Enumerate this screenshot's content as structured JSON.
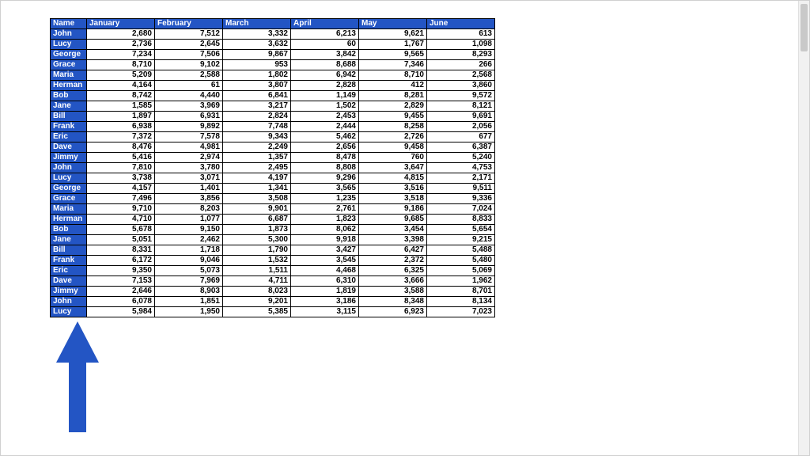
{
  "table": {
    "headers": [
      "Name",
      "January",
      "February",
      "March",
      "April",
      "May",
      "June"
    ],
    "rows": [
      {
        "name": "John",
        "values": [
          "2,680",
          "7,512",
          "3,332",
          "6,213",
          "9,621",
          "613"
        ]
      },
      {
        "name": "Lucy",
        "values": [
          "2,736",
          "2,645",
          "3,632",
          "60",
          "1,767",
          "1,098"
        ]
      },
      {
        "name": "George",
        "values": [
          "7,234",
          "7,506",
          "9,867",
          "3,842",
          "9,565",
          "8,293"
        ]
      },
      {
        "name": "Grace",
        "values": [
          "8,710",
          "9,102",
          "953",
          "8,688",
          "7,346",
          "266"
        ]
      },
      {
        "name": "Maria",
        "values": [
          "5,209",
          "2,588",
          "1,802",
          "6,942",
          "8,710",
          "2,568"
        ]
      },
      {
        "name": "Herman",
        "values": [
          "4,164",
          "61",
          "3,807",
          "2,828",
          "412",
          "3,860"
        ]
      },
      {
        "name": "Bob",
        "values": [
          "8,742",
          "4,440",
          "6,841",
          "1,149",
          "8,281",
          "9,572"
        ]
      },
      {
        "name": "Jane",
        "values": [
          "1,585",
          "3,969",
          "3,217",
          "1,502",
          "2,829",
          "8,121"
        ]
      },
      {
        "name": "Bill",
        "values": [
          "1,897",
          "6,931",
          "2,824",
          "2,453",
          "9,455",
          "9,691"
        ]
      },
      {
        "name": "Frank",
        "values": [
          "6,938",
          "9,892",
          "7,748",
          "2,444",
          "8,258",
          "2,056"
        ]
      },
      {
        "name": "Eric",
        "values": [
          "7,372",
          "7,578",
          "9,343",
          "5,462",
          "2,726",
          "677"
        ]
      },
      {
        "name": "Dave",
        "values": [
          "8,476",
          "4,981",
          "2,249",
          "2,656",
          "9,458",
          "6,387"
        ]
      },
      {
        "name": "Jimmy",
        "values": [
          "5,416",
          "2,974",
          "1,357",
          "8,478",
          "760",
          "5,240"
        ]
      },
      {
        "name": "John",
        "values": [
          "7,810",
          "3,780",
          "2,495",
          "8,808",
          "3,647",
          "4,753"
        ]
      },
      {
        "name": "Lucy",
        "values": [
          "3,738",
          "3,071",
          "4,197",
          "9,296",
          "4,815",
          "2,171"
        ]
      },
      {
        "name": "George",
        "values": [
          "4,157",
          "1,401",
          "1,341",
          "3,565",
          "3,516",
          "9,511"
        ]
      },
      {
        "name": "Grace",
        "values": [
          "7,496",
          "3,856",
          "3,508",
          "1,235",
          "3,518",
          "9,336"
        ]
      },
      {
        "name": "Maria",
        "values": [
          "9,710",
          "8,203",
          "9,901",
          "2,761",
          "9,186",
          "7,024"
        ]
      },
      {
        "name": "Herman",
        "values": [
          "4,710",
          "1,077",
          "6,687",
          "1,823",
          "9,685",
          "8,833"
        ]
      },
      {
        "name": "Bob",
        "values": [
          "5,678",
          "9,150",
          "1,873",
          "8,062",
          "3,454",
          "5,654"
        ]
      },
      {
        "name": "Jane",
        "values": [
          "5,051",
          "2,462",
          "5,300",
          "9,918",
          "3,398",
          "9,215"
        ]
      },
      {
        "name": "Bill",
        "values": [
          "8,331",
          "1,718",
          "1,790",
          "3,427",
          "6,427",
          "5,488"
        ]
      },
      {
        "name": "Frank",
        "values": [
          "6,172",
          "9,046",
          "1,532",
          "3,545",
          "2,372",
          "5,480"
        ]
      },
      {
        "name": "Eric",
        "values": [
          "9,350",
          "5,073",
          "1,511",
          "4,468",
          "6,325",
          "5,069"
        ]
      },
      {
        "name": "Dave",
        "values": [
          "7,153",
          "7,969",
          "4,711",
          "6,310",
          "3,666",
          "1,962"
        ]
      },
      {
        "name": "Jimmy",
        "values": [
          "2,646",
          "8,903",
          "8,023",
          "1,819",
          "3,588",
          "8,701"
        ]
      },
      {
        "name": "John",
        "values": [
          "6,078",
          "1,851",
          "9,201",
          "3,186",
          "8,348",
          "8,134"
        ]
      },
      {
        "name": "Lucy",
        "values": [
          "5,984",
          "1,950",
          "5,385",
          "3,115",
          "6,923",
          "7,023"
        ]
      }
    ]
  },
  "colors": {
    "header": "#2355c4",
    "arrow": "#2355c4"
  }
}
